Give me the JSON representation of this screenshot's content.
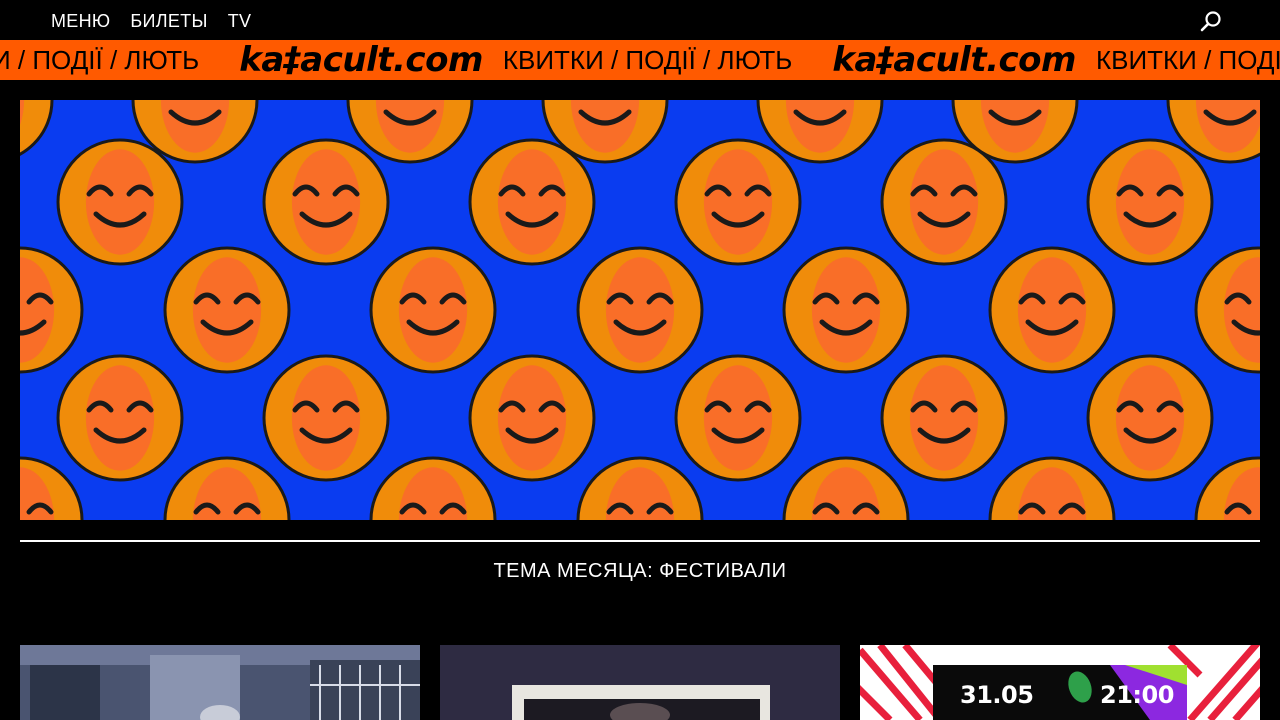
{
  "nav": {
    "items": [
      {
        "label": "МЕНЮ"
      },
      {
        "label": "БИЛЕТЫ"
      },
      {
        "label": "TV"
      }
    ],
    "search_icon": "search-icon"
  },
  "ticker": {
    "lead_text": "И / ПОДІЇ / ЛЮТЬ",
    "logo": "ka‡acult.com",
    "text": "КВИТКИ / ПОДІЇ / ЛЮТЬ",
    "background": "#ff5a00"
  },
  "hero": {
    "background": "#0a3cf0",
    "circle_fill": "#f08c0a",
    "circle_inner": "#ff5a3c"
  },
  "section": {
    "title": "ТЕМА МЕСЯЦА: ФЕСТИВАЛИ"
  },
  "cards": {
    "card3": {
      "date": "31.05",
      "time": "21:00"
    }
  }
}
